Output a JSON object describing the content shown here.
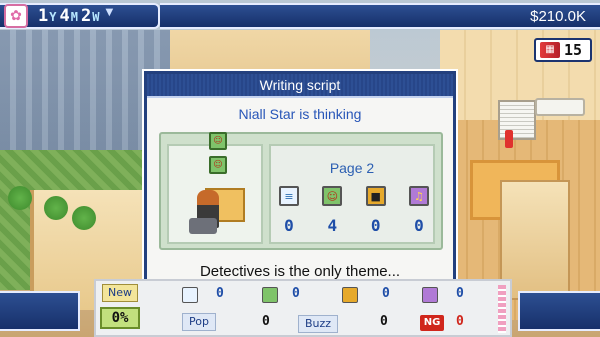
{
  "header": {
    "date": {
      "year_num": "1",
      "year_unit": "Y",
      "month_num": "4",
      "month_unit": "M",
      "week_num": "2",
      "week_unit": "W"
    },
    "flower_icon": "flower-icon",
    "menu_icon": "chevron-down-icon",
    "money": "$210.0K"
  },
  "card_counter": {
    "icon": "cards-icon",
    "value": "15"
  },
  "dialog": {
    "title": "Writing script",
    "status": "Niall Star is thinking",
    "page_label": "Page 2",
    "stats": [
      {
        "icon": "script-icon",
        "value": "0"
      },
      {
        "icon": "people-icon",
        "value": "4"
      },
      {
        "icon": "camera-icon",
        "value": "0"
      },
      {
        "icon": "music-icon",
        "value": "0"
      }
    ],
    "message": "Detectives is the only theme..."
  },
  "bottom_strip": {
    "new_label": "New",
    "percent": "0%",
    "genre_tag": "Pop",
    "buzz_tag": "Buzz",
    "ng_label": "NG",
    "values": {
      "script": "0",
      "people": "0",
      "camera": "0",
      "music": "0",
      "pop": "0",
      "buzz": "0",
      "ng": "0"
    }
  },
  "colors": {
    "bar": "#23407e",
    "accent_blue": "#1f4ea8",
    "ng_red": "#d0261c"
  }
}
